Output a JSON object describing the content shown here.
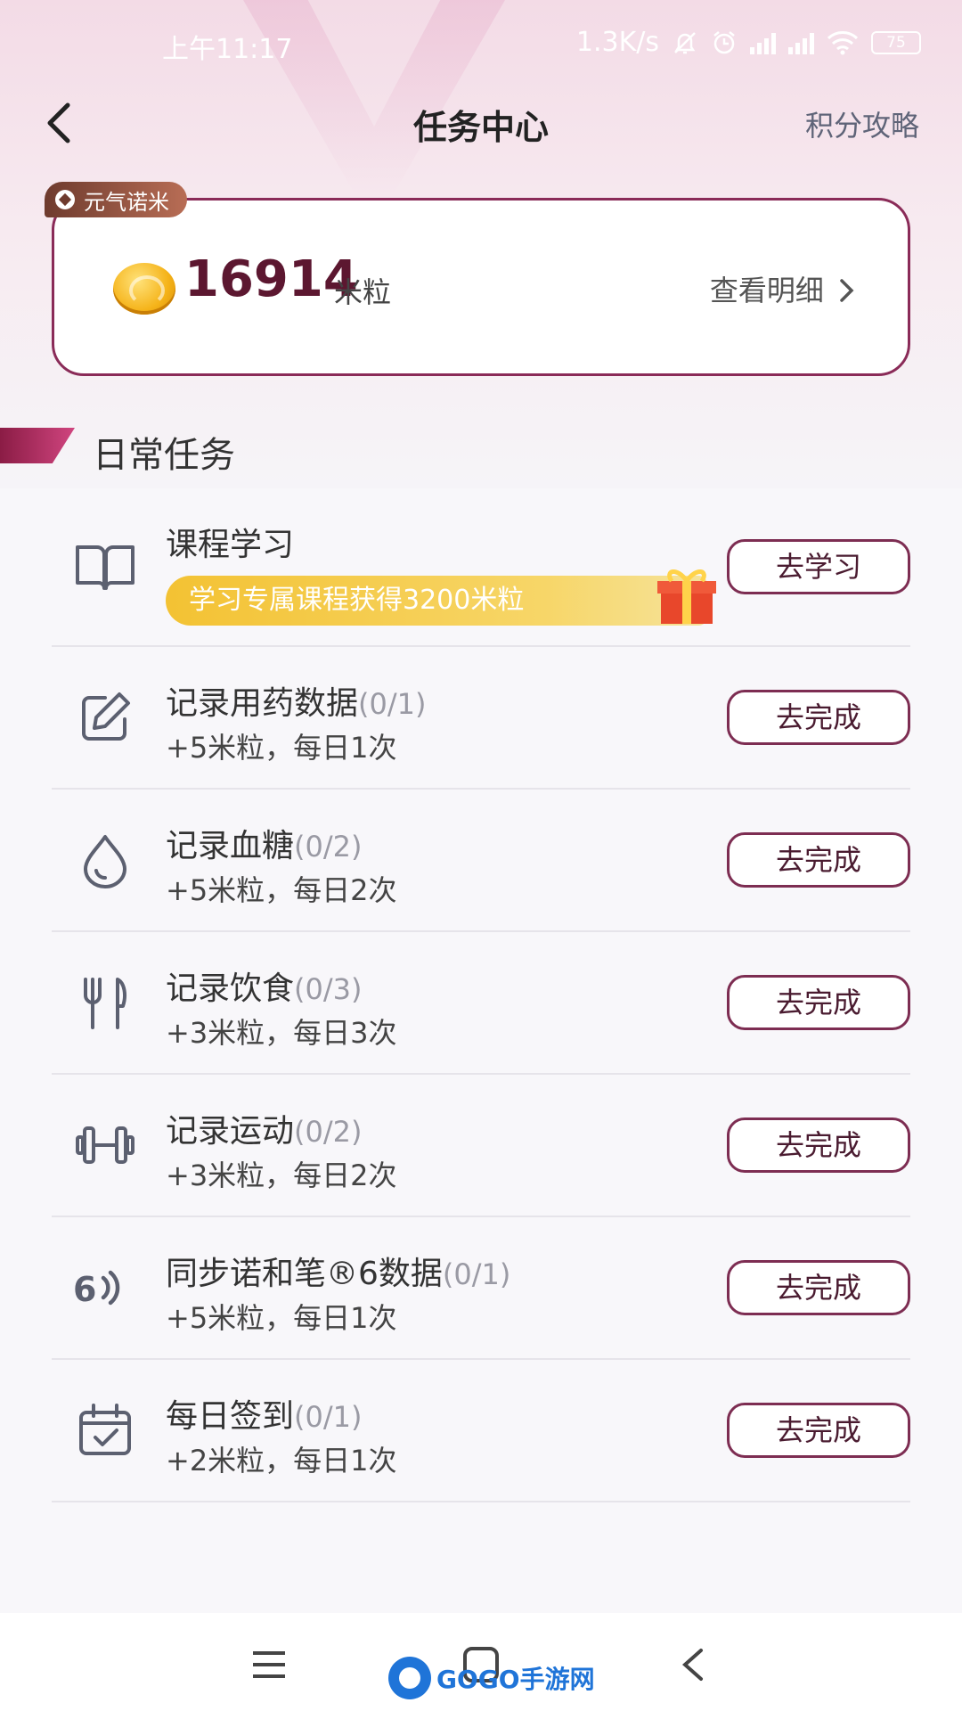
{
  "status_bar": {
    "time": "上午11:17",
    "speed": "1.3K/s",
    "battery": "75"
  },
  "header": {
    "title": "任务中心",
    "guide_link": "积分攻略"
  },
  "points": {
    "brand_tag": "元气诺米",
    "value": "16914",
    "unit": "米粒",
    "detail_link": "查看明细"
  },
  "section": {
    "title": "日常任务"
  },
  "tasks": [
    {
      "icon": "book-icon",
      "name": "课程学习",
      "progress": "",
      "desc": "",
      "promo": "学习专属课程获得3200米粒",
      "button": "去学习"
    },
    {
      "icon": "edit-icon",
      "name": "记录用药数据",
      "progress": "(0/1)",
      "desc": "+5米粒，每日1次",
      "button": "去完成"
    },
    {
      "icon": "drop-icon",
      "name": "记录血糖",
      "progress": "(0/2)",
      "desc": "+5米粒，每日2次",
      "button": "去完成"
    },
    {
      "icon": "fork-knife-icon",
      "name": "记录饮食",
      "progress": "(0/3)",
      "desc": "+3米粒，每日3次",
      "button": "去完成"
    },
    {
      "icon": "dumbbell-icon",
      "name": "记录运动",
      "progress": "(0/2)",
      "desc": "+3米粒，每日2次",
      "button": "去完成"
    },
    {
      "icon": "sync-pen-icon",
      "name": "同步诺和笔®6数据",
      "progress": "(0/1)",
      "desc": "+5米粒，每日1次",
      "button": "去完成"
    },
    {
      "icon": "calendar-check-icon",
      "name": "每日签到",
      "progress": "(0/1)",
      "desc": "+2米粒，每日1次",
      "button": "去完成"
    }
  ],
  "nav": {
    "watermark": "GOGO手游网"
  }
}
